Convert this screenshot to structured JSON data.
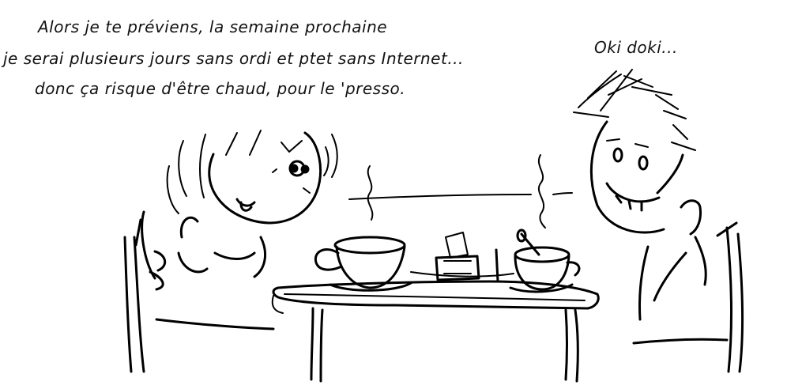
{
  "dialogue": {
    "left_speaker": {
      "lines": [
        "Alors je te préviens, la semaine prochaine",
        "je serai plusieurs jours sans ordi et ptet sans Internet...",
        "donc ça risque d'être chaud, pour le 'presso."
      ]
    },
    "right_speaker": {
      "line": "Oki doki..."
    }
  },
  "colors": {
    "ink": "#000000",
    "paper": "#ffffff"
  }
}
